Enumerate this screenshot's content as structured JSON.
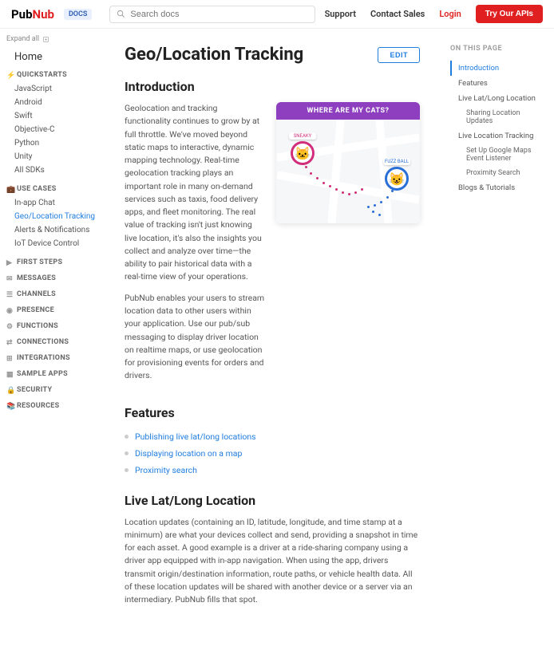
{
  "header": {
    "logo_a": "Pub",
    "logo_b": "Nub",
    "docs_badge": "DOCS",
    "search_placeholder": "Search docs",
    "links": {
      "support": "Support",
      "contact": "Contact Sales",
      "login": "Login"
    },
    "try_btn": "Try Our APIs"
  },
  "sidebar": {
    "expand_all": "Expand all",
    "home": "Home",
    "sections": [
      {
        "title": "QUICKSTARTS",
        "items": [
          "JavaScript",
          "Android",
          "Swift",
          "Objective-C",
          "Python",
          "Unity",
          "All SDKs"
        ]
      },
      {
        "title": "USE CASES",
        "items": [
          "In-app Chat",
          "Geo/Location Tracking",
          "Alerts & Notifications",
          "IoT Device Control"
        ],
        "active": 1
      },
      {
        "title": "FIRST STEPS",
        "items": []
      },
      {
        "title": "MESSAGES",
        "items": []
      },
      {
        "title": "CHANNELS",
        "items": []
      },
      {
        "title": "PRESENCE",
        "items": []
      },
      {
        "title": "FUNCTIONS",
        "items": []
      },
      {
        "title": "CONNECTIONS",
        "items": []
      },
      {
        "title": "INTEGRATIONS",
        "items": []
      },
      {
        "title": "SAMPLE APPS",
        "items": []
      },
      {
        "title": "SECURITY",
        "items": []
      },
      {
        "title": "RESOURCES",
        "items": []
      }
    ]
  },
  "page": {
    "title": "Geo/Location Tracking",
    "edit": "EDIT",
    "intro_heading": "Introduction",
    "intro_p1": "Geolocation and tracking functionality continues to grow by at full throttle. We've moved beyond static maps to interactive, dynamic mapping technology. Real-time geolocation tracking plays an important role in many on-demand services such as taxis, food delivery apps, and fleet monitoring. The real value of tracking isn't just knowing live location, it's also the insights you collect and analyze over time—the ability to pair historical data with a real-time view of your operations.",
    "intro_p2": "PubNub enables your users to stream location data to other users within your application. Use our pub/sub messaging to display driver location on realtime maps, or use geolocation for provisioning events for orders and drivers.",
    "map": {
      "title": "WHERE ARE MY CATS?",
      "pin_a": "SNEAKY",
      "pin_b": "FUZZ BALL"
    },
    "features_heading": "Features",
    "features": [
      "Publishing live lat/long locations",
      "Displaying location on a map",
      "Proximity search"
    ],
    "live_heading": "Live Lat/Long Location",
    "live_p1": "Location updates (containing an ID, latitude, longitude, and time stamp at a minimum) are what your devices collect and send, providing a snapshot in time for each asset. A good example is a driver at a ride-sharing company using a driver app equipped with in-app navigation. When using the app, drivers transmit origin/destination information, route paths, or vehicle health data. All of these location updates will be shared with another device or a server via an intermediary. PubNub fills that spot."
  },
  "toc": {
    "title": "ON THIS PAGE",
    "items": [
      {
        "label": "Introduction",
        "active": true
      },
      {
        "label": "Features"
      },
      {
        "label": "Live Lat/Long Location",
        "sub": [
          "Sharing Location Updates"
        ]
      },
      {
        "label": "Live Location Tracking",
        "sub": [
          "Set Up Google Maps Event Listener",
          "Proximity Search"
        ]
      },
      {
        "label": "Blogs & Tutorials"
      }
    ]
  }
}
